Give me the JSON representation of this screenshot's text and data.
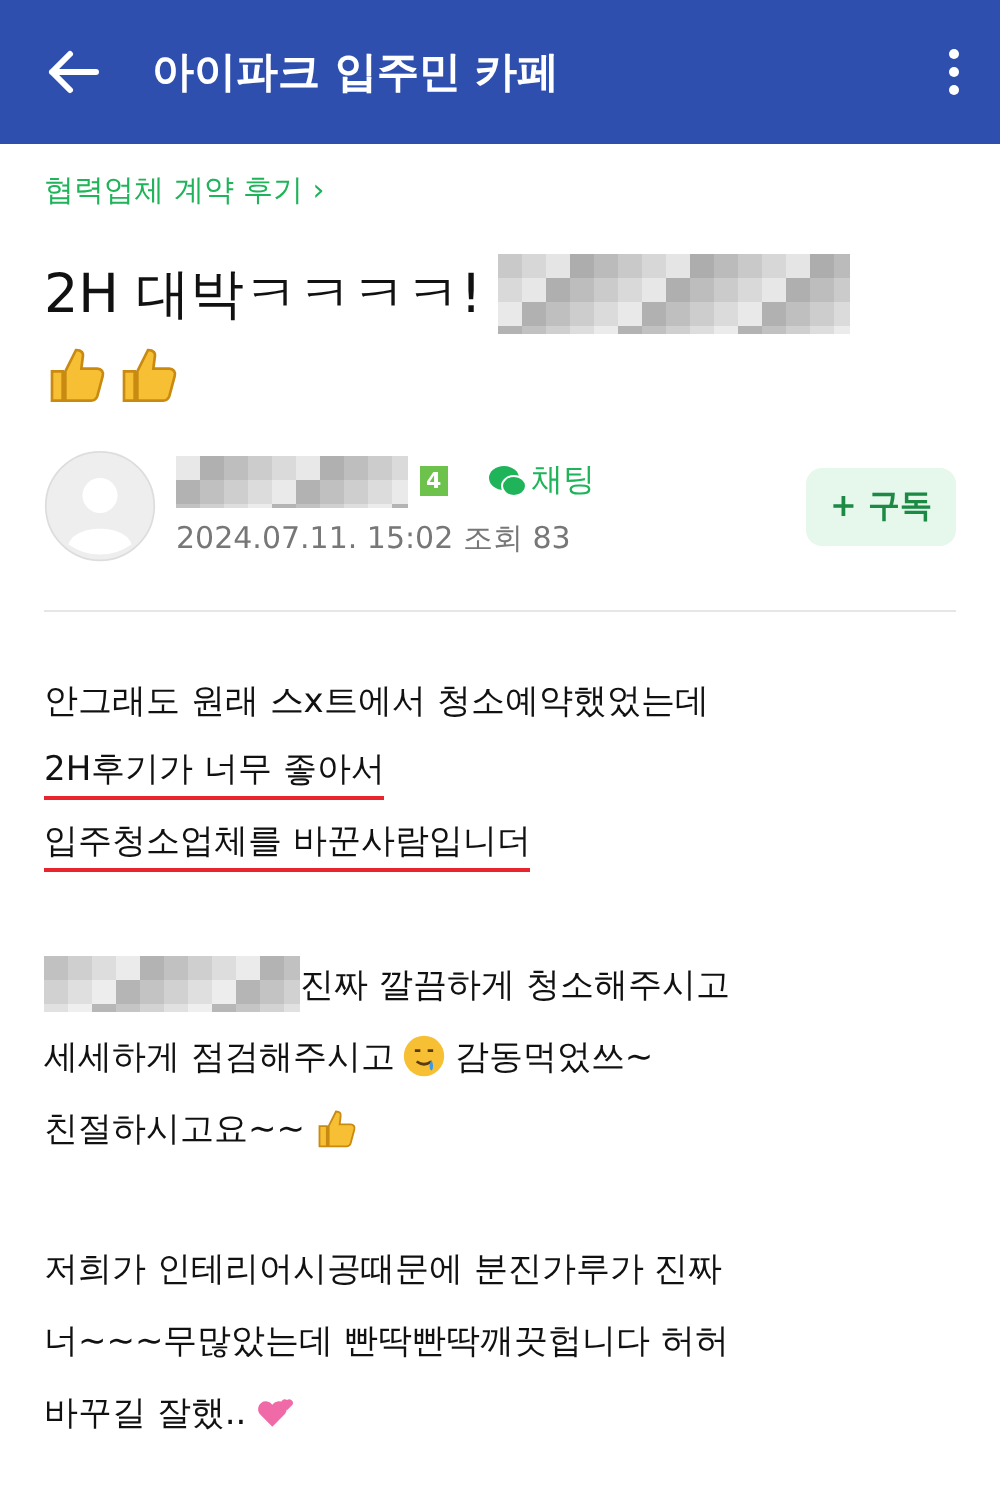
{
  "header": {
    "title": "아이파크 입주민 카페"
  },
  "board_link": "협력업체 계약 후기 ›",
  "post_title": {
    "text": "2H 대박ㅋㅋㅋㅋ!",
    "emojis": [
      {
        "kind": "thumbsup"
      },
      {
        "kind": "thumbsup"
      }
    ]
  },
  "author": {
    "level": "4",
    "chat": "채팅",
    "date": "2024.07.11. 15:02",
    "views": "조회 83",
    "subscribe": "+ 구독"
  },
  "paragraphs": [
    [
      {
        "underlined": false,
        "parts": [
          {
            "kind": "text",
            "text": "안그래도 원래 스x트에서 청소예약했었는데"
          }
        ]
      },
      {
        "underlined": true,
        "parts": [
          {
            "kind": "text",
            "text": "2H후기가 너무 좋아서"
          }
        ]
      },
      {
        "underlined": true,
        "parts": [
          {
            "kind": "text",
            "text": "입주청소업체를 바꾼사람입니더"
          }
        ]
      }
    ],
    [
      {
        "underlined": false,
        "parts": [
          {
            "kind": "mosaic"
          },
          {
            "kind": "text",
            "text": "진짜 깔끔하게 청소해주시고"
          }
        ]
      },
      {
        "underlined": false,
        "parts": [
          {
            "kind": "text",
            "text": "세세하게 점검해주시고"
          },
          {
            "kind": "teary"
          },
          {
            "kind": "text",
            "text": "감동먹었쓰~"
          }
        ]
      },
      {
        "underlined": false,
        "parts": [
          {
            "kind": "text",
            "text": "친절하시고요~~"
          },
          {
            "kind": "thumbsup"
          }
        ]
      }
    ],
    [
      {
        "underlined": false,
        "parts": [
          {
            "kind": "text",
            "text": "저희가 인테리어시공때문에 분진가루가 진짜"
          }
        ]
      },
      {
        "underlined": false,
        "parts": [
          {
            "kind": "text",
            "text": "너~~~무많았는데 빤딱빤딱깨끗헙니다 허허"
          }
        ]
      },
      {
        "underlined": false,
        "parts": [
          {
            "kind": "text",
            "text": "바꾸길 잘했.."
          },
          {
            "kind": "hearts"
          }
        ]
      }
    ]
  ]
}
